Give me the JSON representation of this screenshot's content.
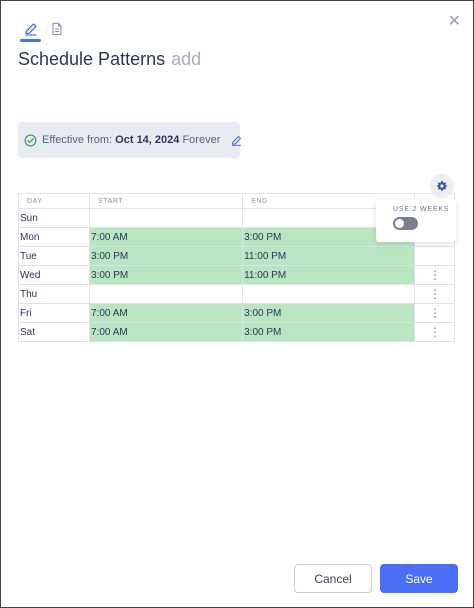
{
  "header": {
    "title": "Schedule Patterns",
    "title_accent": "add",
    "tabs": [
      {
        "icon": "edit-pencil-icon",
        "active": true
      },
      {
        "icon": "document-icon",
        "active": false
      }
    ],
    "close_icon": "close-icon"
  },
  "effective": {
    "label": "Effective from:",
    "date": "Oct 14, 2024",
    "end": "Forever"
  },
  "table": {
    "columns": [
      "DAY",
      "START",
      "END"
    ],
    "rows": [
      {
        "day": "Sun",
        "start": "",
        "end": "",
        "active": false
      },
      {
        "day": "Mon",
        "start": "7:00 AM",
        "end": "3:00 PM",
        "active": true
      },
      {
        "day": "Tue",
        "start": "3:00 PM",
        "end": "11:00 PM",
        "active": true
      },
      {
        "day": "Wed",
        "start": "3:00 PM",
        "end": "11:00 PM",
        "active": true
      },
      {
        "day": "Thu",
        "start": "",
        "end": "",
        "active": false
      },
      {
        "day": "Fri",
        "start": "7:00 AM",
        "end": "3:00 PM",
        "active": true
      },
      {
        "day": "Sat",
        "start": "7:00 AM",
        "end": "3:00 PM",
        "active": true
      }
    ]
  },
  "settings": {
    "use_two_weeks_label": "USE 2 WEEKS",
    "use_two_weeks": false
  },
  "footer": {
    "cancel_label": "Cancel",
    "save_label": "Save"
  },
  "colors": {
    "accent": "#4a6ef5",
    "active_cell": "#b9e6c1",
    "check": "#2e9e4f"
  }
}
